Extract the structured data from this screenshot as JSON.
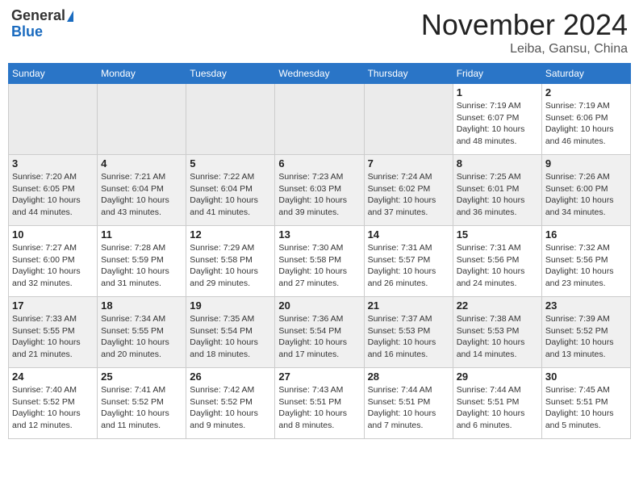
{
  "header": {
    "logo_general": "General",
    "logo_blue": "Blue",
    "month_title": "November 2024",
    "location": "Leiba, Gansu, China"
  },
  "weekdays": [
    "Sunday",
    "Monday",
    "Tuesday",
    "Wednesday",
    "Thursday",
    "Friday",
    "Saturday"
  ],
  "weeks": [
    {
      "row": 1,
      "days": [
        {
          "day": "",
          "info": "",
          "empty": true
        },
        {
          "day": "",
          "info": "",
          "empty": true
        },
        {
          "day": "",
          "info": "",
          "empty": true
        },
        {
          "day": "",
          "info": "",
          "empty": true
        },
        {
          "day": "",
          "info": "",
          "empty": true
        },
        {
          "day": "1",
          "info": "Sunrise: 7:19 AM\nSunset: 6:07 PM\nDaylight: 10 hours\nand 48 minutes.",
          "empty": false
        },
        {
          "day": "2",
          "info": "Sunrise: 7:19 AM\nSunset: 6:06 PM\nDaylight: 10 hours\nand 46 minutes.",
          "empty": false
        }
      ]
    },
    {
      "row": 2,
      "days": [
        {
          "day": "3",
          "info": "Sunrise: 7:20 AM\nSunset: 6:05 PM\nDaylight: 10 hours\nand 44 minutes.",
          "empty": false
        },
        {
          "day": "4",
          "info": "Sunrise: 7:21 AM\nSunset: 6:04 PM\nDaylight: 10 hours\nand 43 minutes.",
          "empty": false
        },
        {
          "day": "5",
          "info": "Sunrise: 7:22 AM\nSunset: 6:04 PM\nDaylight: 10 hours\nand 41 minutes.",
          "empty": false
        },
        {
          "day": "6",
          "info": "Sunrise: 7:23 AM\nSunset: 6:03 PM\nDaylight: 10 hours\nand 39 minutes.",
          "empty": false
        },
        {
          "day": "7",
          "info": "Sunrise: 7:24 AM\nSunset: 6:02 PM\nDaylight: 10 hours\nand 37 minutes.",
          "empty": false
        },
        {
          "day": "8",
          "info": "Sunrise: 7:25 AM\nSunset: 6:01 PM\nDaylight: 10 hours\nand 36 minutes.",
          "empty": false
        },
        {
          "day": "9",
          "info": "Sunrise: 7:26 AM\nSunset: 6:00 PM\nDaylight: 10 hours\nand 34 minutes.",
          "empty": false
        }
      ]
    },
    {
      "row": 3,
      "days": [
        {
          "day": "10",
          "info": "Sunrise: 7:27 AM\nSunset: 6:00 PM\nDaylight: 10 hours\nand 32 minutes.",
          "empty": false
        },
        {
          "day": "11",
          "info": "Sunrise: 7:28 AM\nSunset: 5:59 PM\nDaylight: 10 hours\nand 31 minutes.",
          "empty": false
        },
        {
          "day": "12",
          "info": "Sunrise: 7:29 AM\nSunset: 5:58 PM\nDaylight: 10 hours\nand 29 minutes.",
          "empty": false
        },
        {
          "day": "13",
          "info": "Sunrise: 7:30 AM\nSunset: 5:58 PM\nDaylight: 10 hours\nand 27 minutes.",
          "empty": false
        },
        {
          "day": "14",
          "info": "Sunrise: 7:31 AM\nSunset: 5:57 PM\nDaylight: 10 hours\nand 26 minutes.",
          "empty": false
        },
        {
          "day": "15",
          "info": "Sunrise: 7:31 AM\nSunset: 5:56 PM\nDaylight: 10 hours\nand 24 minutes.",
          "empty": false
        },
        {
          "day": "16",
          "info": "Sunrise: 7:32 AM\nSunset: 5:56 PM\nDaylight: 10 hours\nand 23 minutes.",
          "empty": false
        }
      ]
    },
    {
      "row": 4,
      "days": [
        {
          "day": "17",
          "info": "Sunrise: 7:33 AM\nSunset: 5:55 PM\nDaylight: 10 hours\nand 21 minutes.",
          "empty": false
        },
        {
          "day": "18",
          "info": "Sunrise: 7:34 AM\nSunset: 5:55 PM\nDaylight: 10 hours\nand 20 minutes.",
          "empty": false
        },
        {
          "day": "19",
          "info": "Sunrise: 7:35 AM\nSunset: 5:54 PM\nDaylight: 10 hours\nand 18 minutes.",
          "empty": false
        },
        {
          "day": "20",
          "info": "Sunrise: 7:36 AM\nSunset: 5:54 PM\nDaylight: 10 hours\nand 17 minutes.",
          "empty": false
        },
        {
          "day": "21",
          "info": "Sunrise: 7:37 AM\nSunset: 5:53 PM\nDaylight: 10 hours\nand 16 minutes.",
          "empty": false
        },
        {
          "day": "22",
          "info": "Sunrise: 7:38 AM\nSunset: 5:53 PM\nDaylight: 10 hours\nand 14 minutes.",
          "empty": false
        },
        {
          "day": "23",
          "info": "Sunrise: 7:39 AM\nSunset: 5:52 PM\nDaylight: 10 hours\nand 13 minutes.",
          "empty": false
        }
      ]
    },
    {
      "row": 5,
      "days": [
        {
          "day": "24",
          "info": "Sunrise: 7:40 AM\nSunset: 5:52 PM\nDaylight: 10 hours\nand 12 minutes.",
          "empty": false
        },
        {
          "day": "25",
          "info": "Sunrise: 7:41 AM\nSunset: 5:52 PM\nDaylight: 10 hours\nand 11 minutes.",
          "empty": false
        },
        {
          "day": "26",
          "info": "Sunrise: 7:42 AM\nSunset: 5:52 PM\nDaylight: 10 hours\nand 9 minutes.",
          "empty": false
        },
        {
          "day": "27",
          "info": "Sunrise: 7:43 AM\nSunset: 5:51 PM\nDaylight: 10 hours\nand 8 minutes.",
          "empty": false
        },
        {
          "day": "28",
          "info": "Sunrise: 7:44 AM\nSunset: 5:51 PM\nDaylight: 10 hours\nand 7 minutes.",
          "empty": false
        },
        {
          "day": "29",
          "info": "Sunrise: 7:44 AM\nSunset: 5:51 PM\nDaylight: 10 hours\nand 6 minutes.",
          "empty": false
        },
        {
          "day": "30",
          "info": "Sunrise: 7:45 AM\nSunset: 5:51 PM\nDaylight: 10 hours\nand 5 minutes.",
          "empty": false
        }
      ]
    }
  ]
}
